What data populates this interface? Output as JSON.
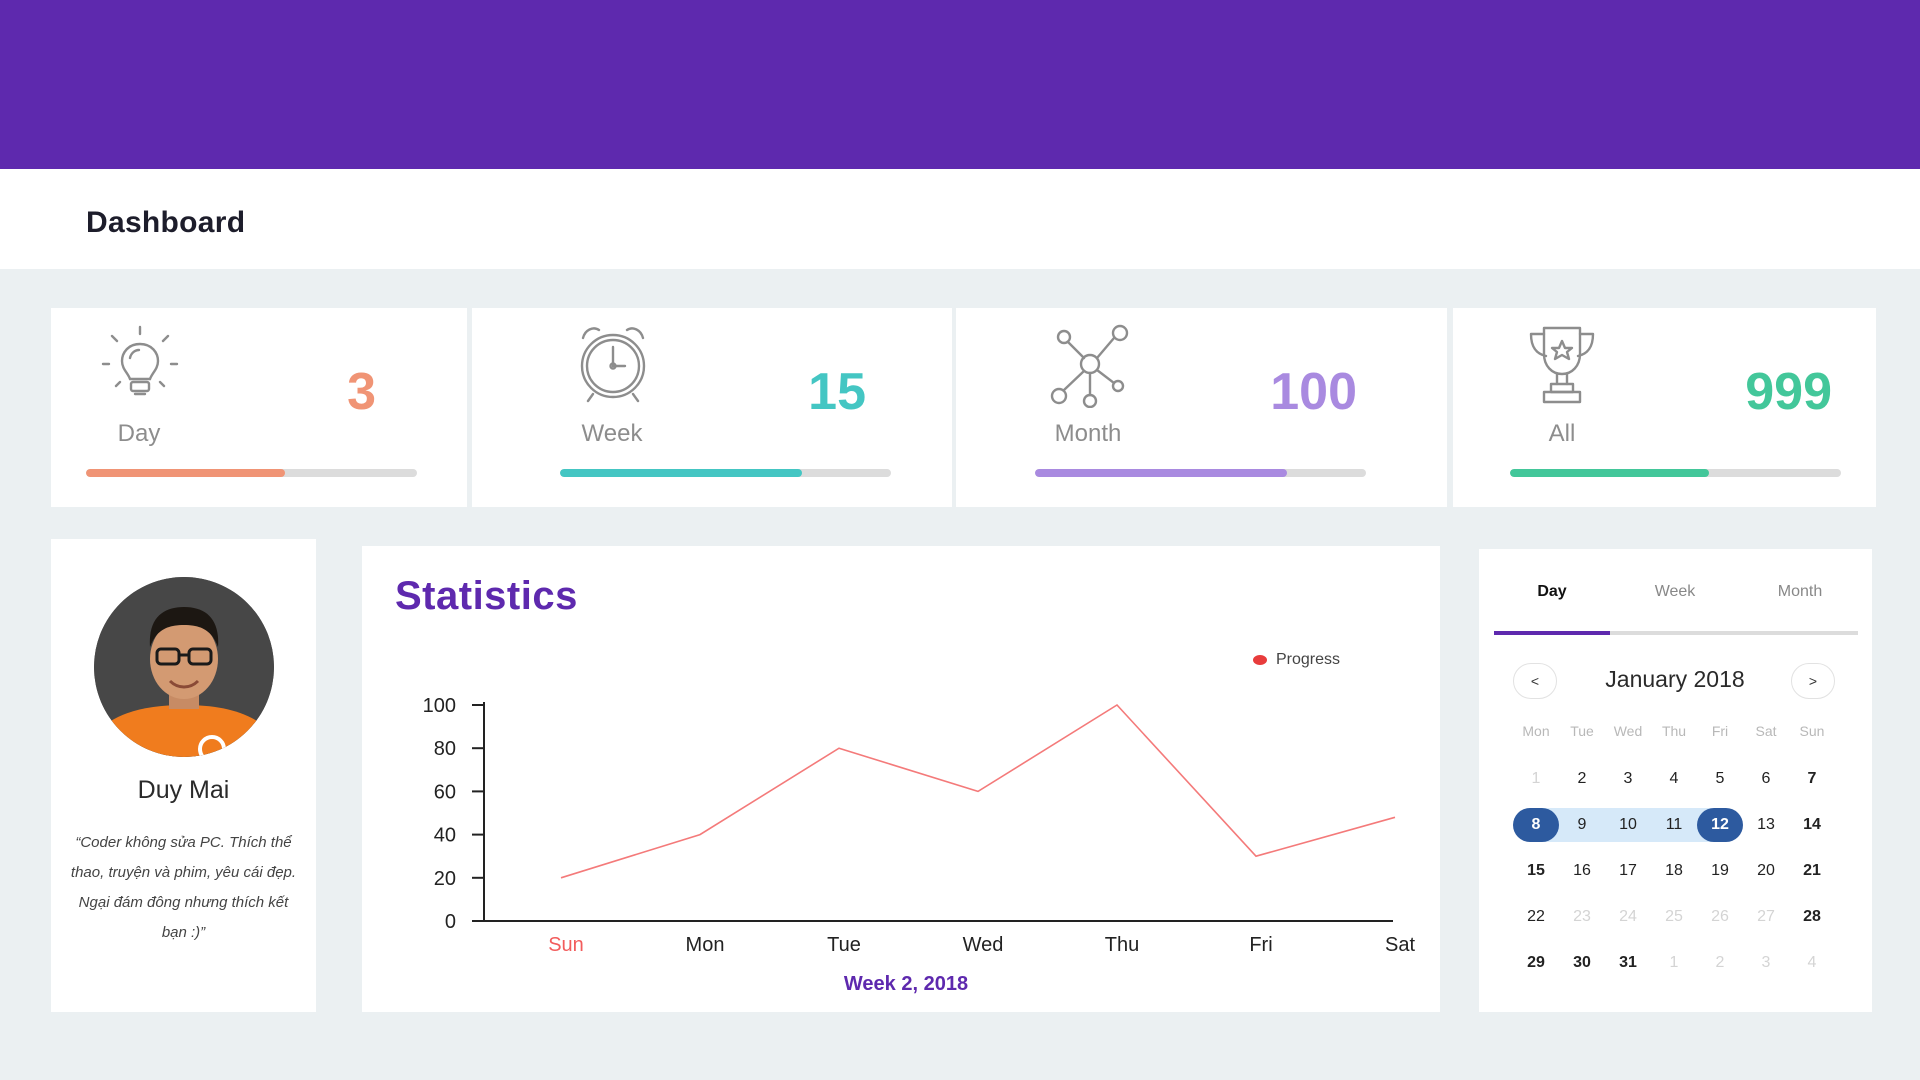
{
  "header": {
    "title": "Dashboard"
  },
  "stats": [
    {
      "label": "Day",
      "value": "3",
      "icon": "lightbulb-icon",
      "color": "#f09475",
      "progress": 0.6
    },
    {
      "label": "Week",
      "value": "15",
      "icon": "alarm-clock-icon",
      "color": "#44c6c3",
      "progress": 0.73
    },
    {
      "label": "Month",
      "value": "100",
      "icon": "network-icon",
      "color": "#a98ae0",
      "progress": 0.76
    },
    {
      "label": "All",
      "value": "999",
      "icon": "trophy-icon",
      "color": "#43c79a",
      "progress": 0.6
    }
  ],
  "profile": {
    "name": "Duy Mai",
    "quote": "“Coder không sửa PC. Thích thể thao, truyện và phim, yêu cái đẹp. Ngại đám đông nhưng thích kết bạn :)”"
  },
  "statistics": {
    "title": "Statistics",
    "legend": "Progress",
    "week_label": "Week 2, 2018"
  },
  "chart_data": {
    "type": "line",
    "categories": [
      "Sun",
      "Mon",
      "Tue",
      "Wed",
      "Thu",
      "Fri",
      "Sat"
    ],
    "series": [
      {
        "name": "Progress",
        "values": [
          20,
          40,
          80,
          60,
          100,
          30,
          48
        ]
      }
    ],
    "yticks": [
      "0",
      "20",
      "40",
      "60",
      "80",
      "100"
    ],
    "ylim": [
      0,
      100
    ],
    "xlabel": "Week 2, 2018",
    "line_color": "#f47a7a",
    "highlight_category_color": "#f25c5c"
  },
  "calendar": {
    "tabs": [
      "Day",
      "Week",
      "Month"
    ],
    "active_tab": "Day",
    "month_label": "January 2018",
    "prev_label": "<",
    "next_label": ">",
    "weekdays": [
      "Mon",
      "Tue",
      "Wed",
      "Thu",
      "Fri",
      "Sat",
      "Sun"
    ],
    "weeks": [
      [
        "1",
        "2",
        "3",
        "4",
        "5",
        "6",
        "7"
      ],
      [
        "8",
        "9",
        "10",
        "11",
        "12",
        "13",
        "14"
      ],
      [
        "15",
        "16",
        "17",
        "18",
        "19",
        "20",
        "21"
      ],
      [
        "22",
        "23",
        "24",
        "25",
        "26",
        "27",
        "28"
      ],
      [
        "29",
        "30",
        "31",
        "1",
        "2",
        "3",
        "4"
      ]
    ],
    "selected_start": "8",
    "selected_end": "12",
    "today": "15",
    "muted_days": [
      [
        0,
        0
      ],
      [
        3,
        1
      ],
      [
        3,
        2
      ],
      [
        3,
        3
      ],
      [
        3,
        4
      ],
      [
        3,
        5
      ],
      [
        4,
        3
      ],
      [
        4,
        4
      ],
      [
        4,
        5
      ],
      [
        4,
        6
      ]
    ]
  },
  "colors": {
    "header_bg": "#5e29ae",
    "accent": "#5e29ae",
    "selected_day": "#2d5a9f",
    "range_bg": "#d6e9f9"
  }
}
